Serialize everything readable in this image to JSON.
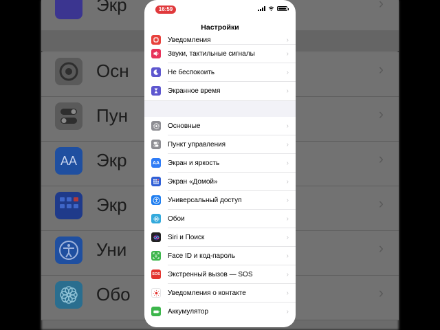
{
  "status": {
    "time": "16:59"
  },
  "nav": {
    "title": "Настройки"
  },
  "groups": [
    {
      "items": [
        {
          "key": "notifications",
          "label": "Уведомления",
          "icon": "bell-icon",
          "color": "#e8413c"
        },
        {
          "key": "sounds",
          "label": "Звуки, тактильные сигналы",
          "icon": "speaker-icon",
          "color": "#e8325a"
        },
        {
          "key": "dnd",
          "label": "Не беспокоить",
          "icon": "moon-icon",
          "color": "#5e57cf"
        },
        {
          "key": "screentime",
          "label": "Экранное время",
          "icon": "hourglass-icon",
          "color": "#5e57cf"
        }
      ]
    },
    {
      "items": [
        {
          "key": "general",
          "label": "Основные",
          "icon": "gear-icon",
          "color": "#8e8e93"
        },
        {
          "key": "control",
          "label": "Пункт управления",
          "icon": "switches-icon",
          "color": "#8e8e93"
        },
        {
          "key": "display",
          "label": "Экран и яркость",
          "icon": "text-size-icon",
          "color": "#2f7cf6"
        },
        {
          "key": "home",
          "label": "Экран «Домой»",
          "icon": "home-grid-icon",
          "color": "#2f5fd6"
        },
        {
          "key": "access",
          "label": "Универсальный доступ",
          "icon": "accessibility-icon",
          "color": "#1f7ef0"
        },
        {
          "key": "wallpaper",
          "label": "Обои",
          "icon": "flower-icon",
          "color": "#34aadc"
        },
        {
          "key": "siri",
          "label": "Siri и Поиск",
          "icon": "siri-icon",
          "color": "#222"
        },
        {
          "key": "faceid",
          "label": "Face ID и код-пароль",
          "icon": "face-id-icon",
          "color": "#3cb64b"
        },
        {
          "key": "sos",
          "label": "Экстренный вызов — SOS",
          "icon": "sos-icon",
          "color": "#e3342f",
          "icon_text": "SOS"
        },
        {
          "key": "contact",
          "label": "Уведомления о контакте",
          "icon": "contact-exposure-icon",
          "color": "#ffffff"
        },
        {
          "key": "battery",
          "label": "Аккумулятор",
          "icon": "battery-icon",
          "color": "#3cb64b"
        }
      ]
    }
  ],
  "background": {
    "rows": [
      {
        "label": "Экр",
        "icon": "hourglass-icon",
        "color": "#3b3590"
      },
      {
        "label": "Осн",
        "icon": "gear-icon",
        "color": "#5a5a5a"
      },
      {
        "label": "Пун",
        "icon": "switches-icon",
        "color": "#5a5a5a"
      },
      {
        "label": "Экр",
        "icon": "text-size-icon",
        "color": "#1f4fa0",
        "icon_text": "AA"
      },
      {
        "label": "Экр",
        "icon": "home-grid-icon",
        "color": "#1f3a8a"
      },
      {
        "label": "Уни",
        "icon": "accessibility-icon",
        "color": "#1f4fa0"
      },
      {
        "label": "Обо",
        "icon": "flower-icon",
        "color": "#2a6e8f"
      }
    ]
  }
}
